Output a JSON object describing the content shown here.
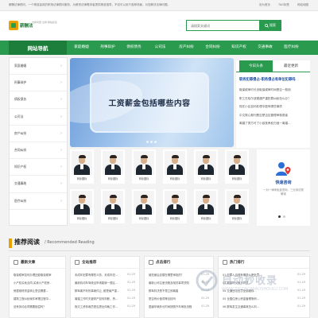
{
  "topbar": {
    "notice": "薪酬法律顾问，一个精准高效的职场法律顾问服务，为薪资法律需求者提供精准指导，不仅可以用于各种场景，为您解决法律问题。",
    "links": [
      "设为首页",
      "TAG标签",
      "网站地图"
    ]
  },
  "header": {
    "logo_text": "薪酬法",
    "logo_sub": "法律问题 法律 网站标签",
    "search_placeholder": "请搜索关键词",
    "search_button": "搜索"
  },
  "nav": {
    "home": "网站导航",
    "items": [
      "家庭婚姻",
      "刑事辩护",
      "债权债务",
      "公司法",
      "房产纠纷",
      "合同纠纷",
      "知识产权",
      "交通事故",
      "医疗纠纷"
    ]
  },
  "sidebar": {
    "items": [
      "家庭婚姻",
      "刑事辩护",
      "债权债务",
      "公司法",
      "房产纠纷",
      "合同纠纷",
      "知识产权",
      "交通事故",
      "医疗纠纷"
    ]
  },
  "banner": {
    "text": "工资薪金包括哪些内容"
  },
  "news": {
    "tab_today": "今日头条",
    "tab_latest": "最近更新",
    "headline": "职务犯罪侵占-职务侵占有单位犯罪吗",
    "items": [
      "取保候审时长涉取保候审时间是否一般用",
      "职工在哈尔滨遭遇严重犯罪纠纷怎么办？",
      "现在小区如何处理中庭有哪些事项",
      "中文核心期刊是否是否应管理审核费者",
      "离婚了男方可了小孩抚养权归谁一离婚..."
    ]
  },
  "photos": {
    "caption": "商标图标",
    "count": 12
  },
  "promo": {
    "title": "快速咨询",
    "desc": "一对一律师免费咨询，三分钟法规解读"
  },
  "recommend": {
    "title": "推荐阅读",
    "subtitle": "/ Recommended Reading"
  },
  "col1": {
    "title": "最新文章",
    "rows": [
      "取保候审如何办理还能取保候审...",
      "小产权买卖合同-买卖小产权房...",
      "房屋维修资金转让是否需要...",
      "建筑工程纠纷案件审理过程中...",
      "没有劳动合同需要赔偿吗？"
    ]
  },
  "col2": {
    "title": "全站推荐",
    "rows": [
      {
        "t": "未成年犯罪有哪些义务，未成年犯...",
        "d": "01-29"
      },
      {
        "t": "最新机动车驾驶证申请能够一般区...",
        "d": "01-29"
      },
      {
        "t": "醉驾离不利刑事案件云, 都是偷严重...",
        "d": "01-29"
      },
      {
        "t": "离婚工作时夫妻财产如何判断，责...",
        "d": "01-29"
      },
      {
        "t": "拖欠工资仲裁员是否提出仲裁工作...",
        "d": "01-29"
      }
    ]
  },
  "col3": {
    "title": "点击排行",
    "rows": [
      {
        "t": "被拍案后遗嘱在哪里审批的？",
        "d": "01-29"
      },
      {
        "t": "最新公司注册流程及相关事项须知",
        "d": "12-07"
      },
      {
        "t": "醉驾判决是不是立即离婚",
        "d": "01-29"
      },
      {
        "t": "是否有价值同等自检吗",
        "d": "01-29"
      },
      {
        "t": "国道车辆多长时间按照汽车审批流程",
        "d": "01-29"
      }
    ]
  },
  "col4": {
    "title": "热门排行",
    "rows": [
      {
        "t": "01 犯罪人自首有哪些从宽处罚...",
        "d": "01-29"
      },
      {
        "t": "03 离婚时父母不同意...",
        "d": "01-29"
      },
      {
        "t": "04 交通违法处罚全部细则...",
        "d": "01-29"
      },
      {
        "t": "05 全国住房公积金管理条例...",
        "d": "01-29"
      },
      {
        "t": "06 醉驾发生交通事故怎么判...",
        "d": "01-29"
      }
    ]
  },
  "watermark": {
    "text": "自动秒收录",
    "url": "WWW.ZIDONGMIAOSHOULU.COM"
  },
  "colors": {
    "brand_green": "#2a9a4e",
    "dark_green": "#1d7d3b",
    "accent_orange": "#e8a100",
    "link_blue": "#1b4aa3"
  }
}
